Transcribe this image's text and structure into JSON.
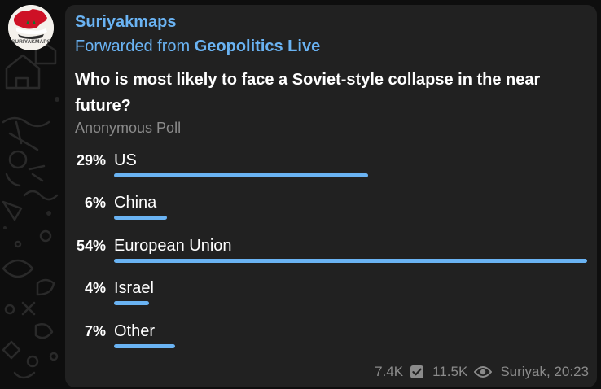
{
  "channel": {
    "name": "Suriyakmaps",
    "avatar_text": "SURIYAKMAPS"
  },
  "forward": {
    "prefix": "Forwarded from",
    "source": "Geopolitics Live"
  },
  "poll": {
    "question": "Who is most likely to face a Soviet-style collapse in the near future?",
    "type": "Anonymous Poll",
    "accent_color": "#6ab3f3",
    "options": [
      {
        "percent_label": "29%",
        "label": "US",
        "fraction": 0.29
      },
      {
        "percent_label": "6%",
        "label": "China",
        "fraction": 0.06
      },
      {
        "percent_label": "54%",
        "label": "European Union",
        "fraction": 0.54
      },
      {
        "percent_label": "4%",
        "label": "Israel",
        "fraction": 0.04
      },
      {
        "percent_label": "7%",
        "label": "Other",
        "fraction": 0.07
      }
    ]
  },
  "footer": {
    "votes": "7.4K",
    "votes_icon": "check-box-icon",
    "views": "11.5K",
    "views_icon": "eye-icon",
    "signature": "Suriyak, 20:23"
  }
}
